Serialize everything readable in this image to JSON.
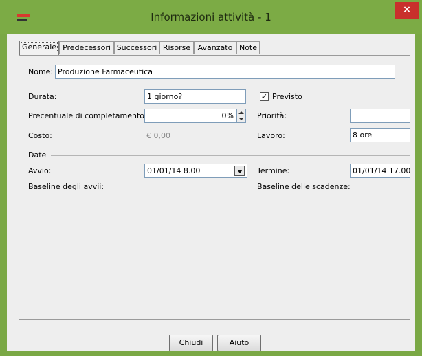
{
  "window": {
    "title": "Informazioni attività - 1",
    "close_glyph": "×"
  },
  "tabs": [
    {
      "label": "Generale"
    },
    {
      "label": "Predecessori"
    },
    {
      "label": "Successori"
    },
    {
      "label": "Risorse"
    },
    {
      "label": "Avanzato"
    },
    {
      "label": "Note"
    }
  ],
  "form": {
    "name_label": "Nome:",
    "name_value": "Produzione Farmaceutica",
    "duration_label": "Durata:",
    "duration_value": "1 giorno?",
    "estimated_label": "Previsto",
    "estimated_checked": true,
    "percent_label": "Precentuale di completamento:",
    "percent_value": "0%",
    "priority_label": "Priorità:",
    "priority_value": "",
    "cost_label": "Costo:",
    "cost_value": "€ 0,00",
    "work_label": "Lavoro:",
    "work_value": "8 ore",
    "dates_section": "Date",
    "start_label": "Avvio:",
    "start_value": "01/01/14 8.00",
    "end_label": "Termine:",
    "end_value": "01/01/14 17.00",
    "baseline_start_label": "Baseline degli avvii:",
    "baseline_end_label": "Baseline delle scadenze:"
  },
  "buttons": {
    "close": "Chiudi",
    "help": "Aiuto"
  }
}
